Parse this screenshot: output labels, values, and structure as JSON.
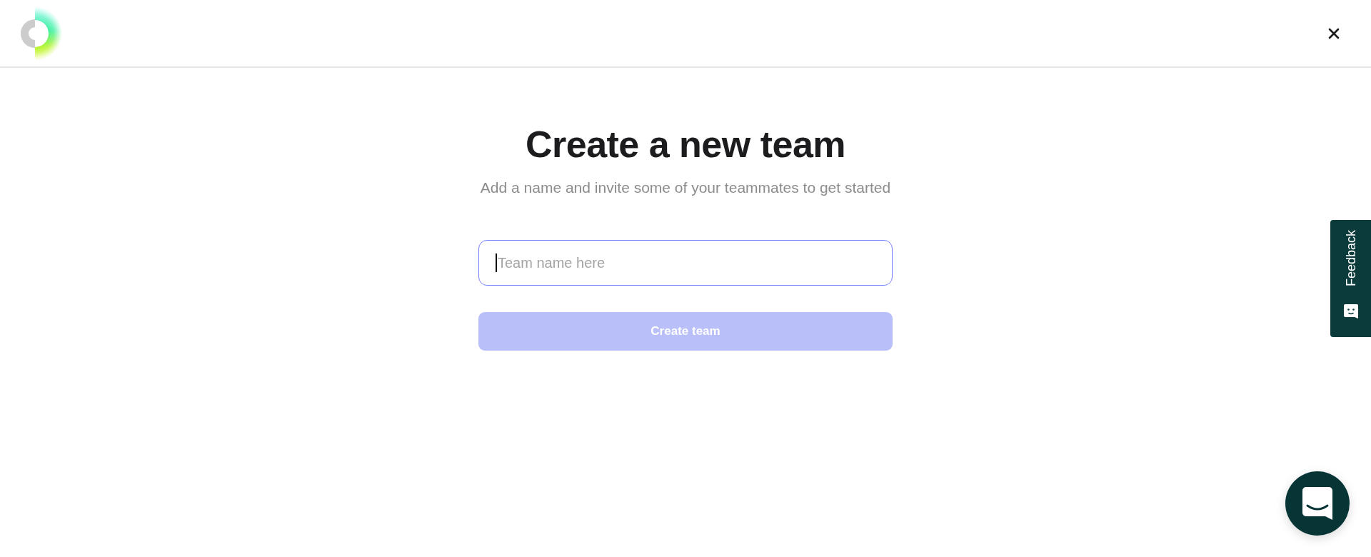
{
  "title": "Create a new team",
  "subtitle": "Add a name and invite some of your teammates to get started",
  "team_name_field": {
    "placeholder": "Team name here",
    "focused": true
  },
  "create_button": {
    "label": "Create team",
    "disabled": true
  },
  "feedback_tab": {
    "label": "Feedback"
  }
}
